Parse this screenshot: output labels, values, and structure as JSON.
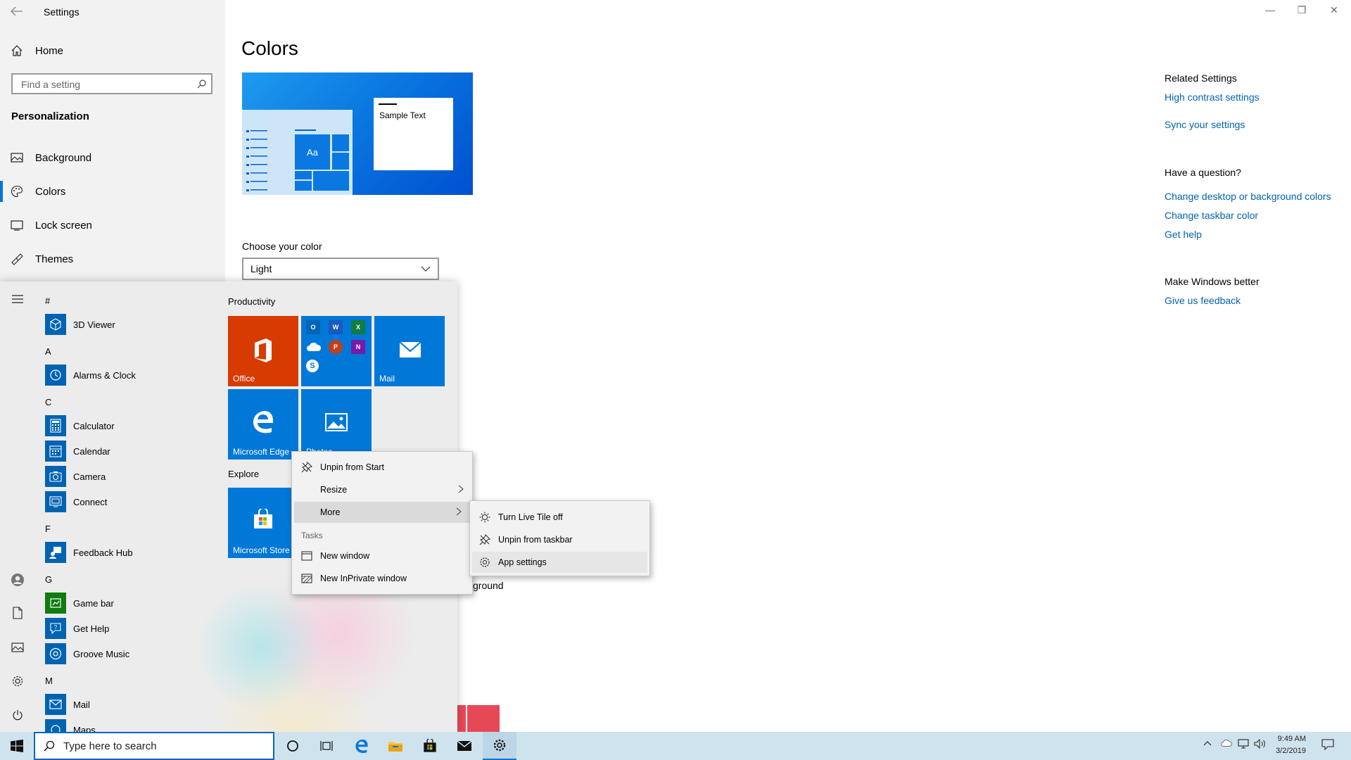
{
  "window": {
    "title": "Settings",
    "minimize": "—",
    "restore": "❐",
    "close": "✕"
  },
  "sidebar": {
    "home": "Home",
    "search_placeholder": "Find a setting",
    "section": "Personalization",
    "items": [
      {
        "label": "Background",
        "icon": "image-icon"
      },
      {
        "label": "Colors",
        "icon": "palette-icon"
      },
      {
        "label": "Lock screen",
        "icon": "lock-screen-icon"
      },
      {
        "label": "Themes",
        "icon": "themes-icon"
      }
    ]
  },
  "main": {
    "title": "Colors",
    "preview_sample_text": "Sample Text",
    "preview_tile_text": "Aa",
    "choose_color_label": "Choose your color",
    "choose_color_value": "Light",
    "partial_label": "ground",
    "accent_color": "#0078d7"
  },
  "related": {
    "heading": "Related Settings",
    "links": [
      "High contrast settings",
      "Sync your settings"
    ],
    "question_heading": "Have a question?",
    "question_links": [
      "Change desktop or background colors",
      "Change taskbar color",
      "Get help"
    ],
    "better_heading": "Make Windows better",
    "better_link": "Give us feedback"
  },
  "start_menu": {
    "letters": [
      "#",
      "A",
      "C",
      "F",
      "G",
      "M"
    ],
    "apps": [
      {
        "name": "3D Viewer",
        "color": "#0063b1"
      },
      {
        "name": "Alarms & Clock",
        "color": "#0063b1"
      },
      {
        "name": "Calculator",
        "color": "#0063b1"
      },
      {
        "name": "Calendar",
        "color": "#0063b1"
      },
      {
        "name": "Camera",
        "color": "#0063b1"
      },
      {
        "name": "Connect",
        "color": "#0063b1"
      },
      {
        "name": "Feedback Hub",
        "color": "#0063b1"
      },
      {
        "name": "Game bar",
        "color": "#107c10"
      },
      {
        "name": "Get Help",
        "color": "#0063b1"
      },
      {
        "name": "Groove Music",
        "color": "#0063b1"
      },
      {
        "name": "Mail",
        "color": "#0063b1"
      },
      {
        "name": "Maps",
        "color": "#0063b1"
      }
    ],
    "groups": [
      "Productivity",
      "Explore"
    ],
    "tiles": {
      "office": "Office",
      "mail": "Mail",
      "edge": "Microsoft Edge",
      "photos": "Photos",
      "store": "Microsoft Store"
    },
    "tile_colors": {
      "office": "#d83b01",
      "blue": "#0078d7"
    }
  },
  "context_menu": {
    "items": [
      "Unpin from Start",
      "Resize",
      "More"
    ],
    "tasks_label": "Tasks",
    "tasks": [
      "New window",
      "New InPrivate window"
    ]
  },
  "sub_menu": {
    "items": [
      "Turn Live Tile off",
      "Unpin from taskbar",
      "App settings"
    ]
  },
  "taskbar": {
    "search_placeholder": "Type here to search",
    "time": "9:49 AM",
    "date": "3/2/2019",
    "color": "#cfe3ee"
  }
}
